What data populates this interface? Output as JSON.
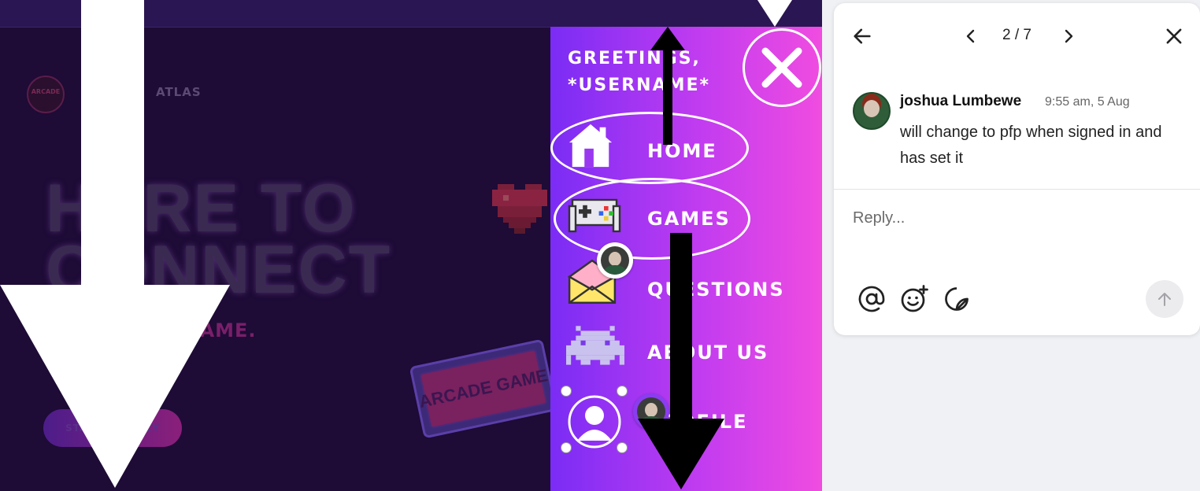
{
  "canvas": {
    "logo_text": "ARCADE",
    "brand_name": "ATLAS",
    "hero_line1": "HERE TO",
    "hero_line2": "CONNECT",
    "tagline": "E. GAME.",
    "start_button": "START JOURNEY",
    "tickets_text": "ARCADE GAME"
  },
  "menu": {
    "greeting_line1": "GREETINGS,",
    "greeting_line2": "*USERNAME*",
    "items": [
      {
        "label": "HOME",
        "icon": "house-icon"
      },
      {
        "label": "GAMES",
        "icon": "gamepad-icon"
      },
      {
        "label": "QUESTIONS",
        "icon": "envelope-icon"
      },
      {
        "label": "ABOUT US",
        "icon": "space-invader-icon"
      },
      {
        "label": "PROFILE",
        "icon": "user-icon"
      }
    ],
    "colors": {
      "gradient_start": "#7a2cf5",
      "gradient_end": "#f04ce0"
    }
  },
  "comment": {
    "pager": "2 / 7",
    "author": "joshua Lumbewe",
    "time": "9:55 am, 5 Aug",
    "body": "will change to pfp when signed in and has set it",
    "reply_placeholder": "Reply...",
    "toolbar": [
      "mention-icon",
      "emoji-add-icon",
      "sticker-icon"
    ]
  }
}
